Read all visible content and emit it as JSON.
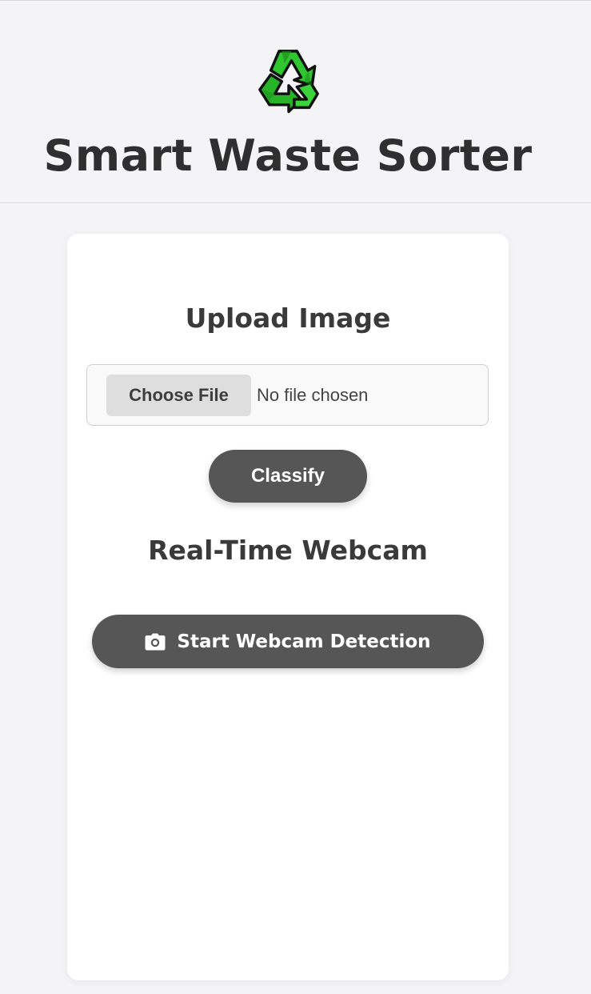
{
  "header": {
    "logo_icon": "recycle-icon",
    "title": "Smart Waste Sorter"
  },
  "upload": {
    "title": "Upload Image",
    "choose_label": "Choose File",
    "file_status": "No file chosen",
    "classify_label": "Classify"
  },
  "webcam": {
    "title": "Real-Time Webcam",
    "button_icon": "camera-icon",
    "button_label": "Start Webcam Detection"
  },
  "colors": {
    "background": "#f4f4f6",
    "card": "#ffffff",
    "button": "#565656",
    "logo_green": "#22c022"
  }
}
